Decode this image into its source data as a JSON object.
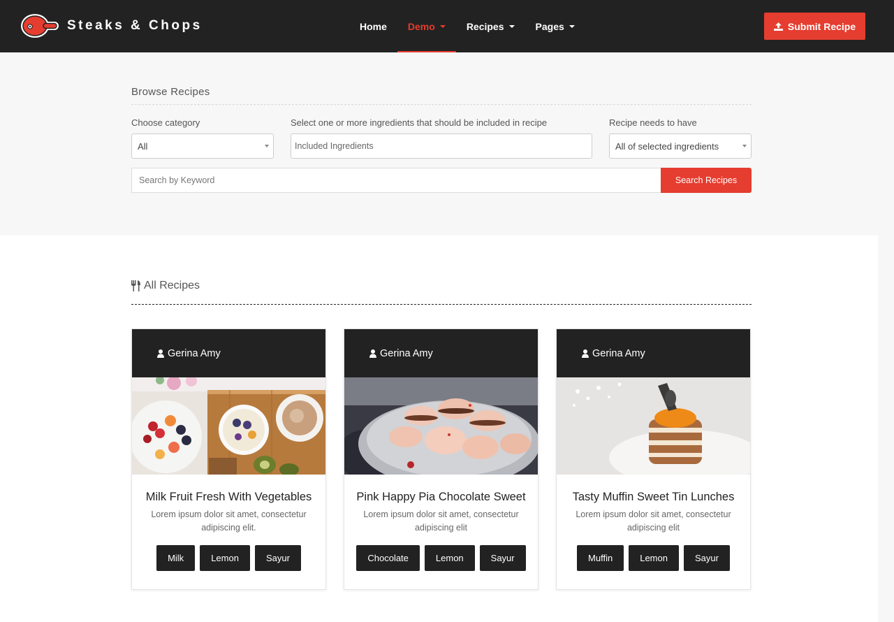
{
  "brand": {
    "name": "Steaks & Chops"
  },
  "nav": {
    "items": [
      {
        "label": "Home"
      },
      {
        "label": "Demo"
      },
      {
        "label": "Recipes"
      },
      {
        "label": "Pages"
      }
    ],
    "active": "Demo",
    "submit_label": "Submit Recipe"
  },
  "browse": {
    "title": "Browse Recipes",
    "category_label": "Choose category",
    "category_value": "All",
    "ingredients_label": "Select one or more ingredients that should be included in recipe",
    "ingredients_placeholder": "Included Ingredients",
    "needs_label": "Recipe needs to have",
    "needs_value": "All of selected ingredients",
    "keyword_placeholder": "Search by Keyword",
    "search_label": "Search Recipes"
  },
  "recipes": {
    "title": "All Recipes",
    "cards": [
      {
        "author": "Gerina Amy",
        "title": "Milk Fruit Fresh With Vegetables",
        "desc": "Lorem ipsum dolor sit amet, consectetur adipiscing elit.",
        "tags": [
          "Milk",
          "Lemon",
          "Sayur"
        ]
      },
      {
        "author": "Gerina Amy",
        "title": "Pink Happy Pia Chocolate Sweet",
        "desc": "Lorem ipsum dolor sit amet, consectetur adipiscing elit",
        "tags": [
          "Chocolate",
          "Lemon",
          "Sayur"
        ]
      },
      {
        "author": "Gerina Amy",
        "title": "Tasty Muffin Sweet Tin Lunches",
        "desc": "Lorem ipsum dolor sit amet, consectetur adipiscing elit",
        "tags": [
          "Muffin",
          "Lemon",
          "Sayur"
        ]
      }
    ]
  },
  "colors": {
    "accent": "#e53d2f",
    "dark": "#222222"
  },
  "icons": [
    "steak-logo-icon",
    "upload-icon",
    "cutlery-icon",
    "user-icon"
  ]
}
